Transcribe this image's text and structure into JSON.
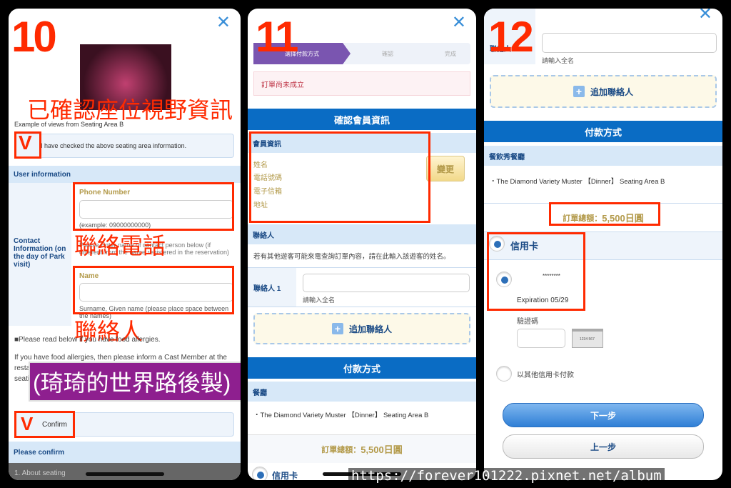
{
  "panel1": {
    "step": "10",
    "overlay_title": "已確認座位視野資訊",
    "image_caption": "Example of views from Seating Area B",
    "seat_check_label": "I have checked the above seating area information.",
    "user_info_header": "User information",
    "contact_label": "Contact Information (on the day of Park visit)",
    "phone_label": "Phone Number",
    "phone_value": "",
    "phone_hint": "(example: 09000000000)",
    "overlay_phone": "聯絡電話",
    "contact_note": "Please Enter name of contact person below (if different from the name registered in the reservation)",
    "name_label": "Name",
    "name_value": "",
    "name_hint": "Surname, Given name (please place space between the names)",
    "overlay_name": "聯絡人",
    "allergy_title": "■Please read below if you have food allergies.",
    "allergy_text": "If you have food allergies, then please inform a Cast Member at the restaurant before your seating time ... 45 minutes before your seating time. For details, tap here",
    "watermark_banner": "(琦琦的世界路後製)",
    "confirm_label": "Confirm",
    "please_confirm": "Please confirm",
    "about_seating": "1. About seating"
  },
  "panel2": {
    "step": "11",
    "steps": [
      "選擇付款方式",
      "確認",
      "完成"
    ],
    "alert": "訂單尚未成立",
    "member_bar": "確認會員資訊",
    "member_header": "會員資訊",
    "member_fields": [
      "姓名",
      "電話號碼",
      "電子信箱",
      "地址"
    ],
    "change_button": "變更",
    "contact_header": "聯絡人",
    "contact_note": "若有其他遊客可能來電查詢訂單內容，請在此輸入該遊客的姓名。",
    "contact1_label": "聯絡人 1",
    "contact1_hint": "請輸入全名",
    "add_contact": "追加聯絡人",
    "payment_bar": "付款方式",
    "restaurant_header": "餐廳",
    "item": "・The Diamond Variety Muster 【Dinner】 Seating Area B",
    "total_label": "訂單總額：",
    "total_value": "5,500日圓",
    "credit_card": "信用卡"
  },
  "panel3": {
    "step": "12",
    "contact1_label": "聯絡人 1",
    "contact1_hint": "請輸入全名",
    "add_contact": "追加聯絡人",
    "payment_bar": "付款方式",
    "restaurant_header": "餐飲秀餐廳",
    "item": "・The Diamond Variety Muster 【Dinner】 Seating Area B",
    "total_label": "訂單總額：",
    "total_value": "5,500日圓",
    "credit_card": "信用卡",
    "card_masked": "********",
    "expiration": "Expiration 05/29",
    "cvv_label": "驗證碼",
    "cvv_sample": "1234 567",
    "other_card": "以其他信用卡付款",
    "next_button": "下一步",
    "prev_button": "上一步"
  },
  "watermark_url": "https://forever101222.pixnet.net/album",
  "colors": {
    "accent": "#0a6cc4",
    "annotation": "#ff2a00",
    "banner": "#8e1f8f"
  }
}
